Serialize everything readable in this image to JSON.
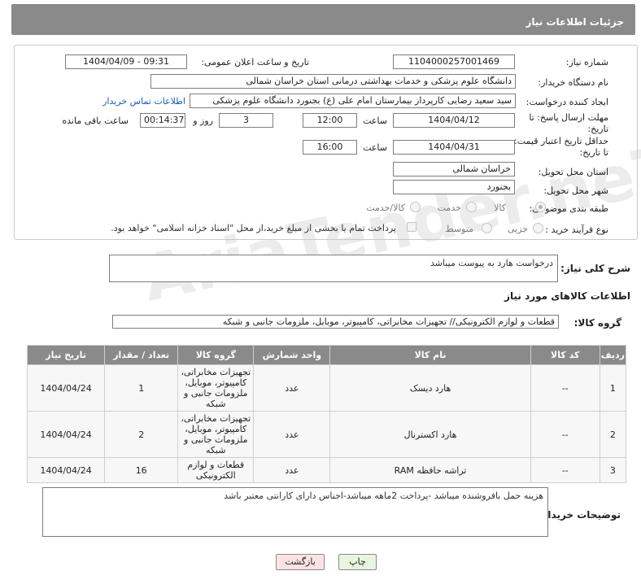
{
  "header": {
    "title": "جزئیات اطلاعات نیاز"
  },
  "form": {
    "need_number": {
      "label": "شماره نیاز:",
      "value": "1104000257001469"
    },
    "announce": {
      "label": "تاریخ و ساعت اعلان عمومی:",
      "value": "1404/04/09 - 09:31"
    },
    "buyer_org": {
      "label": "نام دستگاه خریدار:",
      "value": "دانشگاه علوم پزشکی و خدمات بهداشتی درمانی استان خراسان شمالی"
    },
    "creator": {
      "label": "ایجاد کننده درخواست:",
      "value": "سید سعید رضایی کارپرداز بیمارستان امام علی (ع) بجنورد دانشگاه علوم پزشکی",
      "contact_link": "اطلاعات تماس خریدار"
    },
    "deadline": {
      "label_line1": "مهلت ارسال پاسخ: تا",
      "label_line2": "تاریخ:",
      "date": "1404/04/12",
      "time_label": "ساعت",
      "time": "12:00",
      "days": "3",
      "days_label": "روز و",
      "remaining": "00:14:37",
      "remaining_label": "ساعت باقی مانده"
    },
    "price_validity": {
      "label_line1": "حداقل تاریخ اعتبار قیمت:",
      "label_line2": "تا تاریخ:",
      "date": "1404/04/31",
      "time_label": "ساعت",
      "time": "16:00"
    },
    "province": {
      "label": "استان محل تحویل:",
      "value": "خراسان شمالی"
    },
    "city": {
      "label": "شهر محل تحویل:",
      "value": "بجنورد"
    },
    "category": {
      "label": "طبقه بندی موضوعی:",
      "options": [
        "کالا",
        "خدمت",
        "کالا/خدمت"
      ],
      "selected": "کالا"
    },
    "purchase_type": {
      "label": "نوع فرآیند خرید :",
      "options": [
        "جزیی",
        "متوسط"
      ],
      "note": "پرداخت تمام یا بخشی از مبلغ خرید،از محل \"اسناد خزانه اسلامی\" خواهد بود."
    }
  },
  "summary": {
    "label": "شرح کلی نیاز:",
    "value": "درخواست هارد به پیوست میباشد"
  },
  "goods_info_title": "اطلاعات کالاهای مورد نیاز",
  "goods_group": {
    "label": "گروه کالا:",
    "value": "قطعات و لوازم الکترونیکی// تجهیزات مخابراتی، کامپیوتر، موبایل، ملزومات جانبی و شبکه"
  },
  "table": {
    "headers": [
      "ردیف",
      "کد کالا",
      "نام کالا",
      "واحد شمارش",
      "گروه کالا",
      "تعداد / مقدار",
      "تاریخ نیاز"
    ],
    "rows": [
      [
        "1",
        "--",
        "هارد دیسک",
        "عدد",
        "تجهیزات مخابراتی، کامپیوتر، موبایل، ملزومات جانبی و شبکه",
        "1",
        "1404/04/24"
      ],
      [
        "2",
        "--",
        "هارد اکسترنال",
        "عدد",
        "تجهیزات مخابراتی، کامپیوتر، موبایل، ملزومات جانبی و شبکه",
        "2",
        "1404/04/24"
      ],
      [
        "3",
        "--",
        "تراشه حافظه RAM",
        "عدد",
        "قطعات و لوازم الکترونیکی",
        "16",
        "1404/04/24"
      ]
    ]
  },
  "buyer_notes": {
    "label": "توضیحات خریدار:",
    "value": "هزینه حمل بافروشنده میباشد -پرداخت 2ماهه میباشد-اجناس دارای کارانتی معتبر باشد"
  },
  "buttons": {
    "print": "چاپ",
    "back": "بازگشت"
  },
  "watermark": "AriaTender.neT"
}
